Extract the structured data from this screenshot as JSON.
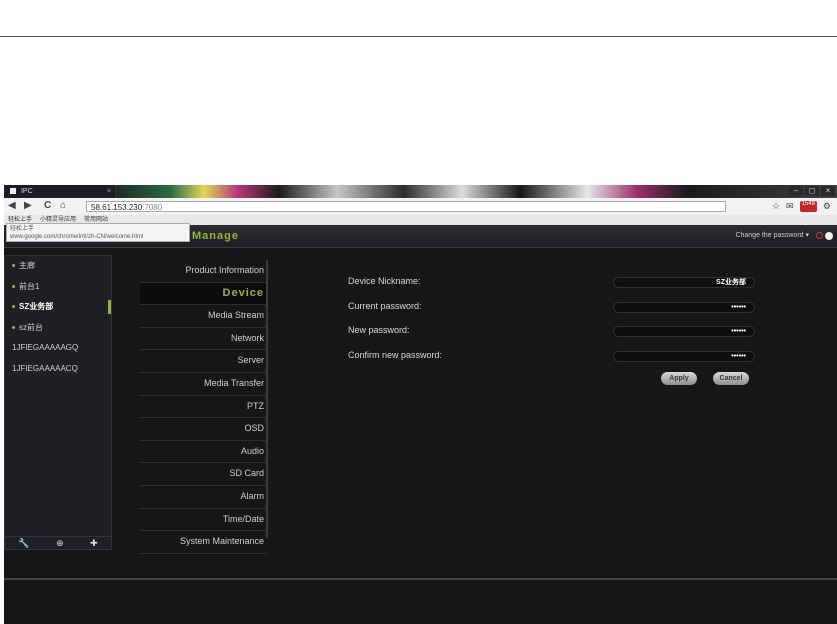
{
  "browser": {
    "tab_title": "IPC",
    "tab_close": "×",
    "window_controls": [
      "–",
      "◻",
      "×"
    ],
    "nav": {
      "back": "◀",
      "forward": "▶",
      "reload": "C",
      "home": "⌂"
    },
    "address": {
      "host": "58.61.153.230",
      "port": ":7080"
    },
    "nav_badge": "1548",
    "bookmarks": [
      "轻松上手",
      "小精灵导应用",
      "常用网站"
    ],
    "status_bubble": {
      "line1": "轻松上手",
      "line2": "www.google.com/chrome/intl/zh-CN/welcome.html"
    }
  },
  "app": {
    "title": "Manage",
    "change_password": "Change the password ▾"
  },
  "devices": [
    {
      "label": "主廊",
      "dot": true,
      "active": false
    },
    {
      "label": "前台1",
      "dot": true,
      "active": false
    },
    {
      "label": "SZ业务部",
      "dot": true,
      "active": true
    },
    {
      "label": "sz前台",
      "dot": true,
      "active": false
    },
    {
      "label": "1JFIEGAAAAAGQ",
      "dot": false,
      "active": false
    },
    {
      "label": "1JFIEGAAAAACQ",
      "dot": false,
      "active": false
    }
  ],
  "device_tools": [
    "wrench-icon",
    "search-icon",
    "add-icon"
  ],
  "menu": [
    {
      "label": "Product Information",
      "active": false
    },
    {
      "label": "Device",
      "active": true
    },
    {
      "label": "Media Stream",
      "active": false
    },
    {
      "label": "Network",
      "active": false
    },
    {
      "label": "Server",
      "active": false
    },
    {
      "label": "Media Transfer",
      "active": false
    },
    {
      "label": "PTZ",
      "active": false
    },
    {
      "label": "OSD",
      "active": false
    },
    {
      "label": "Audio",
      "active": false
    },
    {
      "label": "SD Card",
      "active": false
    },
    {
      "label": "Alarm",
      "active": false
    },
    {
      "label": "Time/Date",
      "active": false
    },
    {
      "label": "System Maintenance",
      "active": false
    }
  ],
  "form": {
    "nickname_label": "Device Nickname:",
    "nickname_value": "SZ业务部",
    "current_label": "Current password:",
    "current_value": "••••••",
    "new_label": "New password:",
    "new_value": "••••••",
    "confirm_label": "Confirm new password:",
    "confirm_value": "••••••",
    "apply": "Apply",
    "cancel": "Cancel"
  },
  "colors": {
    "accent": "#8fb63a",
    "background": "#151618"
  }
}
